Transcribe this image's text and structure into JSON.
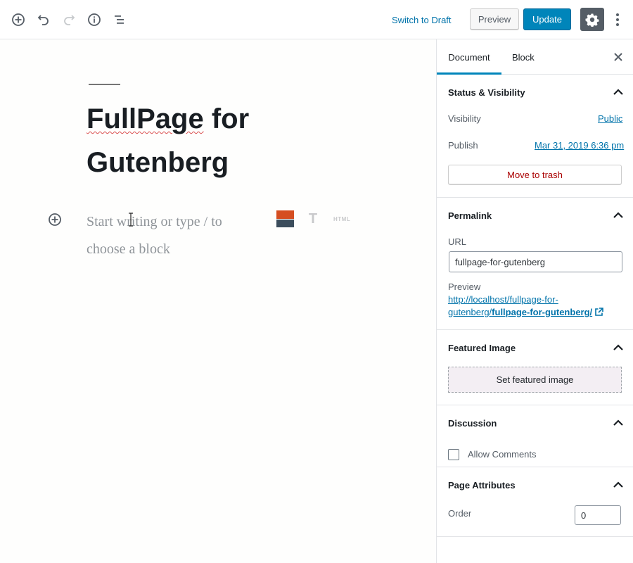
{
  "toolbar": {
    "icons": [
      "add-block-icon",
      "undo-icon",
      "redo-icon",
      "info-icon",
      "block-navigation-icon"
    ],
    "switch_to_draft": "Switch to Draft",
    "preview": "Preview",
    "update": "Update",
    "settings_icon": "gear-icon",
    "more_icon": "more-vertical-icon"
  },
  "editor": {
    "title_line1": "FullPage",
    "title_line1_rest": " for",
    "title_line2": "Gutenberg",
    "placeholder": "Start writing or type / to choose a block",
    "shortcut_html": "HTML"
  },
  "sidebar": {
    "tabs": [
      {
        "label": "Document",
        "active": true
      },
      {
        "label": "Block",
        "active": false
      }
    ],
    "status": {
      "title": "Status & Visibility",
      "visibility_label": "Visibility",
      "visibility_value": "Public",
      "publish_label": "Publish",
      "publish_value": "Mar 31, 2019 6:36 pm",
      "trash": "Move to trash"
    },
    "permalink": {
      "title": "Permalink",
      "url_label": "URL",
      "url_value": "fullpage-for-gutenberg",
      "preview_label": "Preview",
      "preview_link_start": "http://localhost/fullpage-for-",
      "preview_link_mid": "gutenberg/",
      "preview_link_slug": "fullpage-for-gutenberg/"
    },
    "featured": {
      "title": "Featured Image",
      "button": "Set featured image"
    },
    "discussion": {
      "title": "Discussion",
      "allow_comments": "Allow Comments"
    },
    "page_attributes": {
      "title": "Page Attributes",
      "order_label": "Order",
      "order_value": "0"
    }
  },
  "colors": {
    "accent": "#0085ba",
    "link": "#0073aa",
    "danger": "#a00",
    "settings_bg": "#555d66"
  }
}
